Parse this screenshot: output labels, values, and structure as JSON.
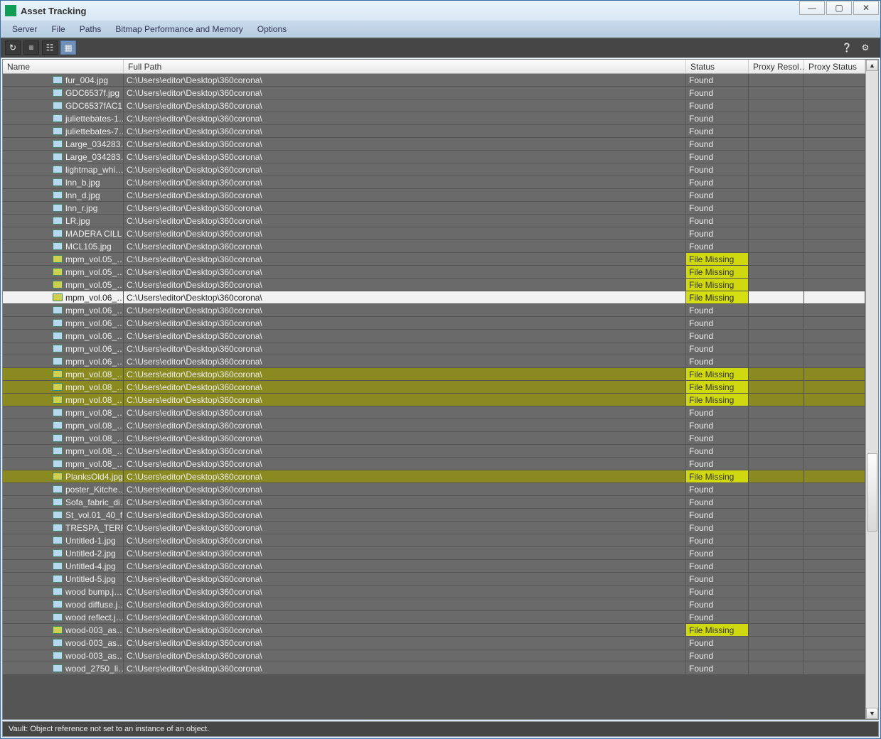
{
  "window": {
    "title": "Asset Tracking"
  },
  "menus": [
    "Server",
    "File",
    "Paths",
    "Bitmap Performance and Memory",
    "Options"
  ],
  "columns": {
    "name": "Name",
    "fullpath": "Full Path",
    "status": "Status",
    "proxyres": "Proxy Resol…",
    "proxystat": "Proxy Status"
  },
  "default_path": "C:\\Users\\editor\\Desktop\\360corona\\",
  "rows": [
    {
      "name": "fur_004.jpg",
      "status": "Found"
    },
    {
      "name": "GDC6537f.jpg",
      "status": "Found"
    },
    {
      "name": "GDC6537fAC1…",
      "status": "Found"
    },
    {
      "name": "juliettebates-1…",
      "status": "Found"
    },
    {
      "name": "juliettebates-7…",
      "status": "Found"
    },
    {
      "name": "Large_034283…",
      "status": "Found"
    },
    {
      "name": "Large_034283…",
      "status": "Found"
    },
    {
      "name": "lightmap_whi…",
      "status": "Found"
    },
    {
      "name": "lnn_b.jpg",
      "status": "Found"
    },
    {
      "name": "lnn_d.jpg",
      "status": "Found"
    },
    {
      "name": "lnn_r.jpg",
      "status": "Found"
    },
    {
      "name": "LR.jpg",
      "status": "Found"
    },
    {
      "name": "MADERA CILL…",
      "status": "Found"
    },
    {
      "name": "MCL105.jpg",
      "status": "Found"
    },
    {
      "name": "mpm_vol.05_…",
      "status": "File Missing"
    },
    {
      "name": "mpm_vol.05_…",
      "status": "File Missing"
    },
    {
      "name": "mpm_vol.05_…",
      "status": "File Missing"
    },
    {
      "name": "mpm_vol.06_…",
      "status": "File Missing",
      "selected": true
    },
    {
      "name": "mpm_vol.06_…",
      "status": "Found"
    },
    {
      "name": "mpm_vol.06_…",
      "status": "Found"
    },
    {
      "name": "mpm_vol.06_…",
      "status": "Found"
    },
    {
      "name": "mpm_vol.06_…",
      "status": "Found"
    },
    {
      "name": "mpm_vol.06_…",
      "status": "Found"
    },
    {
      "name": "mpm_vol.08_…",
      "status": "File Missing",
      "hl": true
    },
    {
      "name": "mpm_vol.08_…",
      "status": "File Missing",
      "hl": true
    },
    {
      "name": "mpm_vol.08_…",
      "status": "File Missing",
      "hl": true
    },
    {
      "name": "mpm_vol.08_…",
      "status": "Found"
    },
    {
      "name": "mpm_vol.08_…",
      "status": "Found"
    },
    {
      "name": "mpm_vol.08_…",
      "status": "Found"
    },
    {
      "name": "mpm_vol.08_…",
      "status": "Found"
    },
    {
      "name": "mpm_vol.08_…",
      "status": "Found"
    },
    {
      "name": "PlanksOld4.jpg",
      "status": "File Missing",
      "hl": true
    },
    {
      "name": "poster_Kitche…",
      "status": "Found"
    },
    {
      "name": "Sofa_fabric_di…",
      "status": "Found"
    },
    {
      "name": "St_vol.01_40_f…",
      "status": "Found"
    },
    {
      "name": "TRESPA_TERR…",
      "status": "Found"
    },
    {
      "name": "Untitled-1.jpg",
      "status": "Found"
    },
    {
      "name": "Untitled-2.jpg",
      "status": "Found"
    },
    {
      "name": "Untitled-4.jpg",
      "status": "Found"
    },
    {
      "name": "Untitled-5.jpg",
      "status": "Found"
    },
    {
      "name": "wood bump.j…",
      "status": "Found"
    },
    {
      "name": "wood diffuse.j…",
      "status": "Found"
    },
    {
      "name": "wood reflect.j…",
      "status": "Found"
    },
    {
      "name": "wood-003_as…",
      "status": "File Missing"
    },
    {
      "name": "wood-003_as…",
      "status": "Found"
    },
    {
      "name": "wood-003_as…",
      "status": "Found"
    },
    {
      "name": "wood_2750_li…",
      "status": "Found"
    }
  ],
  "status_text": "Vault: Object reference not set to an instance of an object."
}
